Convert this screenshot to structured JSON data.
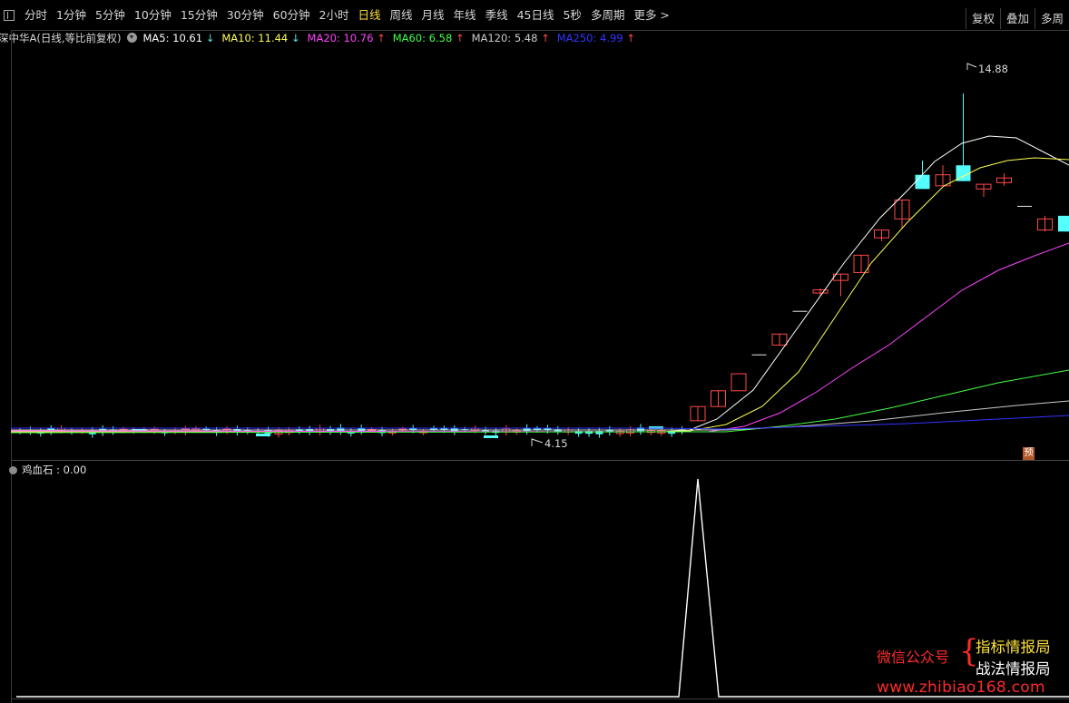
{
  "toolbar": {
    "periods": [
      "分时",
      "1分钟",
      "5分钟",
      "10分钟",
      "15分钟",
      "30分钟",
      "60分钟",
      "2小时",
      "日线",
      "周线",
      "月线",
      "年线",
      "季线",
      "45日线",
      "5秒",
      "多周期",
      "更多 >"
    ],
    "active_period": "日线",
    "right_buttons": [
      "复权",
      "叠加",
      "多周"
    ]
  },
  "legend": {
    "title": "深中华A(日线,等比前复权)",
    "items": [
      {
        "label": "MA5: 10.61",
        "arrow": "↓",
        "color": "#ffffff"
      },
      {
        "label": "MA10: 11.44",
        "arrow": "↓",
        "color": "#ffff55"
      },
      {
        "label": "MA20: 10.76",
        "arrow": "↑",
        "color": "#ff44ff"
      },
      {
        "label": "MA60: 6.58",
        "arrow": "↑",
        "color": "#44ff44"
      },
      {
        "label": "MA120: 5.48",
        "arrow": "↑",
        "color": "#cccccc"
      },
      {
        "label": "MA250: 4.99",
        "arrow": "↑",
        "color": "#3333ff"
      }
    ]
  },
  "annotations": {
    "high": "14.88",
    "low": "4.15",
    "badge": "预"
  },
  "indicator": {
    "title": "鸡血石 : 0.00"
  },
  "watermark": {
    "left": "微信公众号",
    "brace": "{",
    "right1": "指标情报局",
    "right2": "战法情报局",
    "url": "www.zhibiao168.com"
  },
  "colors": {
    "up": "#ff4848",
    "down": "#55ffff",
    "ma5": "#ffffff",
    "ma10": "#ffff55",
    "ma20": "#ff44ff",
    "ma60": "#44ff44",
    "ma120": "#cccccc",
    "ma250": "#3333ff"
  },
  "chart_data": {
    "type": "candlestick",
    "price_range": [
      4.15,
      14.88
    ],
    "candles_recent": [
      {
        "open": 4.5,
        "close": 4.95,
        "high": 4.95,
        "low": 4.5
      },
      {
        "open": 4.95,
        "close": 5.45,
        "high": 5.45,
        "low": 4.95
      },
      {
        "open": 5.45,
        "close": 5.99,
        "high": 5.99,
        "low": 5.99
      },
      {
        "open": 6.59,
        "close": 6.59,
        "high": 6.59,
        "low": 6.59
      },
      {
        "open": 6.9,
        "close": 7.25,
        "high": 7.25,
        "low": 6.9
      },
      {
        "open": 7.97,
        "close": 7.97,
        "high": 7.97,
        "low": 7.97
      },
      {
        "open": 8.55,
        "close": 8.65,
        "high": 8.7,
        "low": 8.45
      },
      {
        "open": 8.95,
        "close": 9.15,
        "high": 9.15,
        "low": 8.45
      },
      {
        "open": 9.2,
        "close": 9.75,
        "high": 9.75,
        "low": 9.2
      },
      {
        "open": 10.3,
        "close": 10.55,
        "high": 10.55,
        "low": 10.2
      },
      {
        "open": 10.9,
        "close": 11.5,
        "high": 11.5,
        "low": 10.6
      },
      {
        "open": 12.3,
        "close": 11.85,
        "high": 12.75,
        "low": 11.85
      },
      {
        "open": 11.95,
        "close": 12.3,
        "high": 12.6,
        "low": 11.95
      },
      {
        "open": 12.6,
        "close": 12.1,
        "high": 14.88,
        "low": 12.1
      },
      {
        "open": 11.85,
        "close": 12.0,
        "high": 12.0,
        "low": 11.6
      },
      {
        "open": 12.05,
        "close": 12.2,
        "high": 12.35,
        "low": 11.95
      },
      {
        "open": 11.3,
        "close": 11.3,
        "high": 11.3,
        "low": 11.3
      },
      {
        "open": 10.55,
        "close": 10.9,
        "high": 11.0,
        "low": 10.5
      },
      {
        "open": 11.0,
        "close": 10.5,
        "high": 11.0,
        "low": 10.5
      }
    ],
    "indicator_values": [
      0,
      0,
      0,
      1,
      0,
      0
    ]
  }
}
